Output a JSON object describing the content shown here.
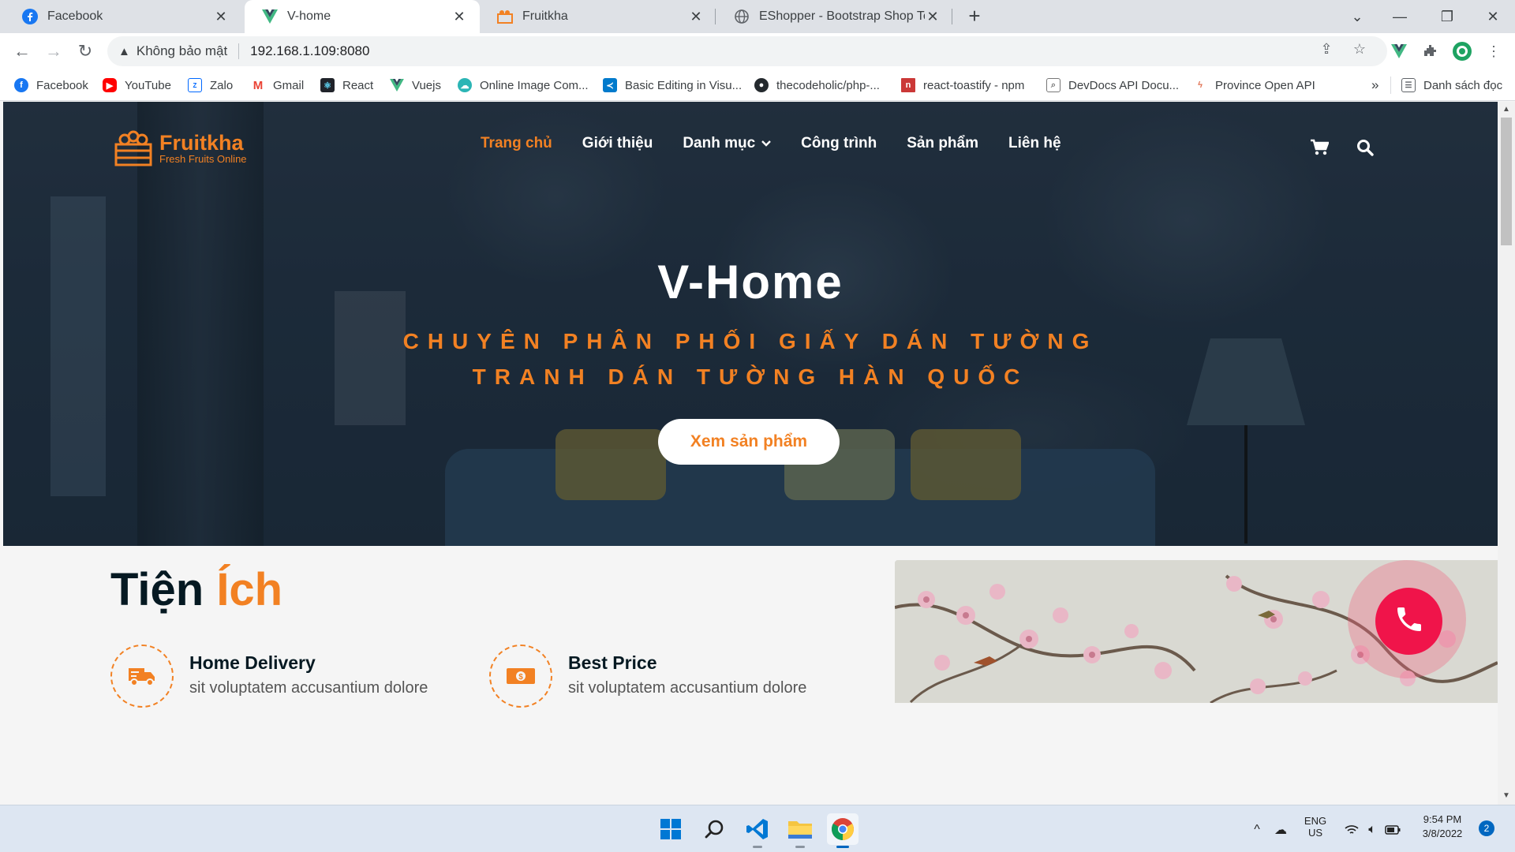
{
  "browser": {
    "tabs": [
      {
        "title": "Facebook",
        "icon": "facebook-icon",
        "active": false
      },
      {
        "title": "V-home",
        "icon": "vue-icon",
        "active": true
      },
      {
        "title": "Fruitkha",
        "icon": "fruitkha-icon",
        "active": false
      },
      {
        "title": "EShopper - Bootstrap Shop Temp",
        "icon": "globe-icon",
        "active": false
      }
    ],
    "new_tab": "+",
    "security_label": "Không bảo mật",
    "url": "192.168.1.109:8080",
    "bookmarks": [
      {
        "label": "Facebook",
        "icon": "facebook-icon",
        "color": "#1877f2"
      },
      {
        "label": "YouTube",
        "icon": "youtube-icon",
        "color": "#ff0000"
      },
      {
        "label": "Zalo",
        "icon": "zalo-icon",
        "color": "#0068ff"
      },
      {
        "label": "Gmail",
        "icon": "gmail-icon",
        "color": "#ea4335"
      },
      {
        "label": "React",
        "icon": "react-icon",
        "color": "#20232a"
      },
      {
        "label": "Vuejs",
        "icon": "vue-icon",
        "color": "#41b883"
      },
      {
        "label": "Online Image Com...",
        "icon": "cloud-icon",
        "color": "#2bb5b5"
      },
      {
        "label": "Basic Editing in Visu...",
        "icon": "vscode-icon",
        "color": "#007acc"
      },
      {
        "label": "thecodeholic/php-...",
        "icon": "github-icon",
        "color": "#24292e"
      },
      {
        "label": "react-toastify - npm",
        "icon": "npm-icon",
        "color": "#cb3837"
      },
      {
        "label": "DevDocs API Docu...",
        "icon": "devdocs-icon",
        "color": "#777777"
      },
      {
        "label": "Province Open API",
        "icon": "api-icon",
        "color": "#e07050"
      }
    ],
    "more_bookmarks": "»",
    "reading_list": "Danh sách đọc"
  },
  "site": {
    "logo_name": "Fruitkha",
    "logo_tagline": "Fresh Fruits Online",
    "nav": [
      {
        "label": "Trang chủ",
        "active": true
      },
      {
        "label": "Giới thiệu",
        "active": false
      },
      {
        "label": "Danh mục",
        "active": false,
        "dropdown": true
      },
      {
        "label": "Công trình",
        "active": false
      },
      {
        "label": "Sản phẩm",
        "active": false
      },
      {
        "label": "Liên hệ",
        "active": false
      }
    ],
    "hero": {
      "title": "V-Home",
      "subtitle_line1": "CHUYÊN PHÂN PHỐI GIẤY DÁN TƯỜNG",
      "subtitle_line2": "TRANH DÁN TƯỜNG HÀN QUỐC",
      "button": "Xem sản phẩm"
    },
    "utilities": {
      "title_part1": "Tiện",
      "title_part2": "Ích",
      "features": [
        {
          "title": "Home Delivery",
          "desc": "sit voluptatem accusantium dolore",
          "icon": "truck-icon"
        },
        {
          "title": "Best Price",
          "desc": "sit voluptatem accusantium dolore",
          "icon": "money-icon"
        }
      ]
    },
    "accent_color": "#f28123",
    "call_button_color": "#f0144a"
  },
  "taskbar": {
    "lang_line1": "ENG",
    "lang_line2": "US",
    "time": "9:54 PM",
    "date": "3/8/2022",
    "notifications": "2"
  }
}
